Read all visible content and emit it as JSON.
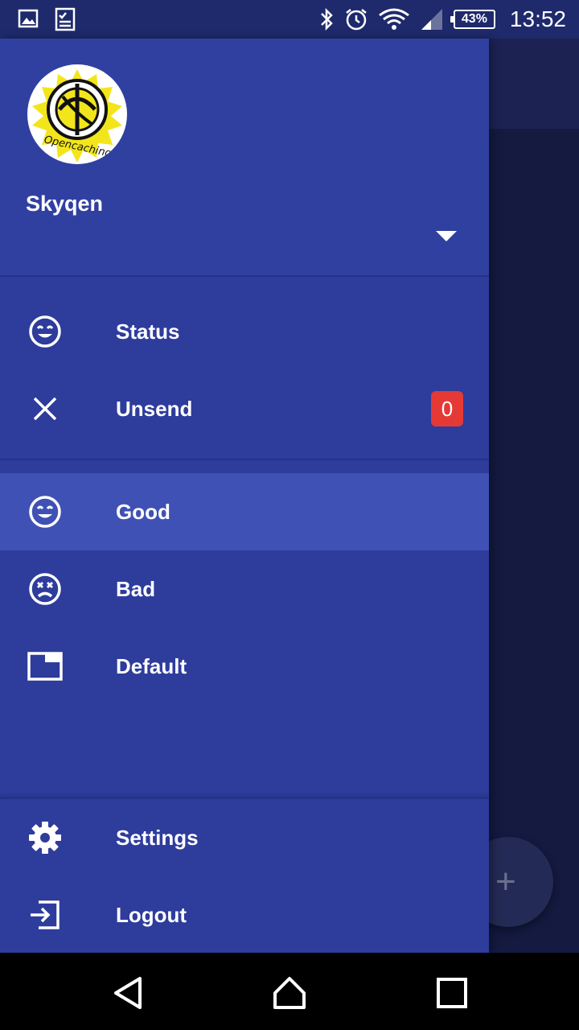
{
  "status_bar": {
    "time": "13:52",
    "battery": "43%",
    "icons": [
      "image-icon",
      "task-icon",
      "bluetooth-icon",
      "alarm-icon",
      "wifi-icon",
      "signal-icon",
      "battery-icon"
    ]
  },
  "drawer": {
    "header": {
      "avatar_logo_text": "Opencaching",
      "account_name": "Skyqen"
    },
    "items": [
      {
        "label": "Status",
        "icon": "happy-face-icon"
      },
      {
        "label": "Unsend",
        "icon": "close-icon",
        "badge": "0"
      }
    ],
    "filters": [
      {
        "label": "Good",
        "icon": "happy-face-icon",
        "selected": true
      },
      {
        "label": "Bad",
        "icon": "dead-face-icon"
      },
      {
        "label": "Default",
        "icon": "window-icon"
      }
    ],
    "footer": [
      {
        "label": "Settings",
        "icon": "gear-icon"
      },
      {
        "label": "Logout",
        "icon": "logout-icon"
      }
    ]
  },
  "fab": {
    "icon": "plus-icon",
    "symbol": "+"
  },
  "colors": {
    "drawer": "#2e3c9c",
    "selected": "#3f51b5",
    "badge": "#e53935"
  }
}
